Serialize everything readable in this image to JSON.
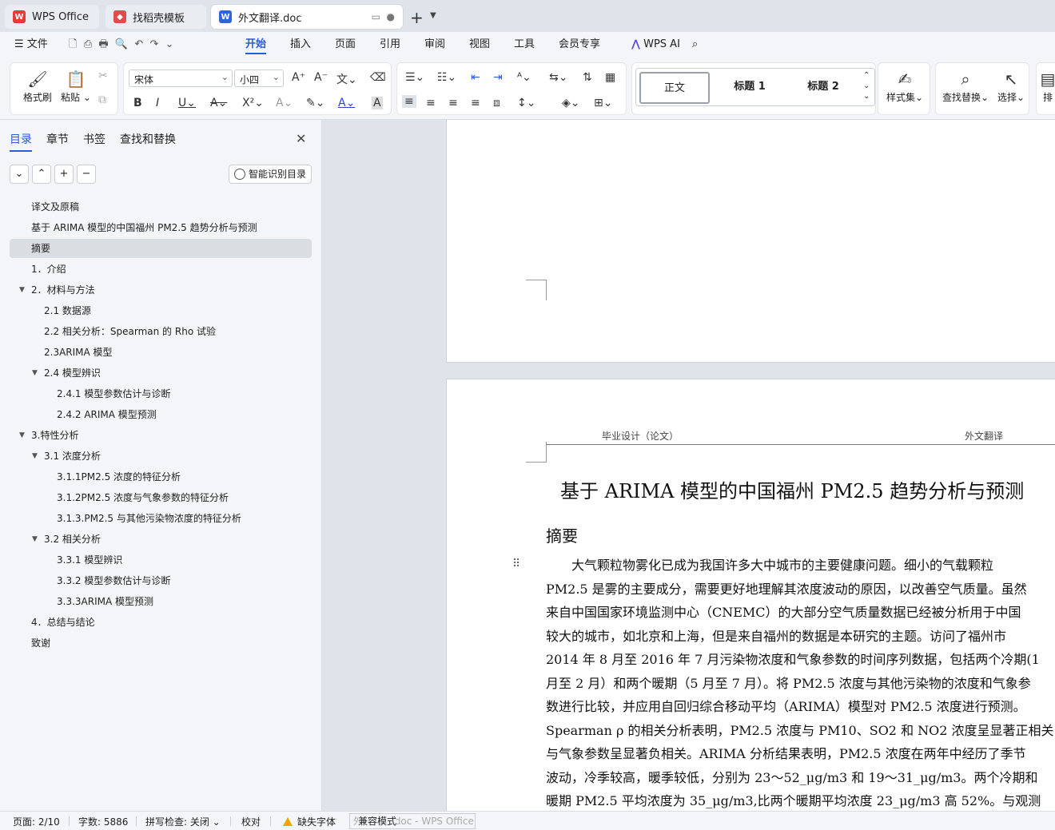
{
  "tabs": [
    {
      "label": "WPS Office",
      "icon": "wps-logo-icon"
    },
    {
      "label": "找稻壳模板",
      "icon": "docer-icon"
    },
    {
      "label": "外文翻译.doc",
      "icon": "writer-doc-icon"
    }
  ],
  "menu": {
    "file": "文件",
    "items": [
      "开始",
      "插入",
      "页面",
      "引用",
      "审阅",
      "视图",
      "工具",
      "会员专享"
    ],
    "active": "开始",
    "ai": "WPS AI"
  },
  "ribbon": {
    "format_painter": "格式刷",
    "paste": "粘贴",
    "font_name": "宋体",
    "font_size": "小四",
    "styles": [
      "正文",
      "标题 1",
      "标题 2"
    ],
    "style_set": "样式集",
    "find_replace": "查找替换",
    "select": "选择",
    "arrange": "排"
  },
  "nav": {
    "tabs": [
      "目录",
      "章节",
      "书签",
      "查找和替换"
    ],
    "active_tab": "目录",
    "smart_button": "智能识别目录",
    "toc": [
      {
        "text": "译文及原稿",
        "level": 1,
        "expanded": null
      },
      {
        "text": "基于 ARIMA 模型的中国福州 PM2.5 趋势分析与预测",
        "level": 1,
        "expanded": null
      },
      {
        "text": "摘要",
        "level": 1,
        "expanded": null,
        "selected": true
      },
      {
        "text": "1．介绍",
        "level": 1,
        "expanded": null
      },
      {
        "text": "2．材料与方法",
        "level": 1,
        "expanded": true
      },
      {
        "text": "2.1 数据源",
        "level": 2,
        "expanded": null
      },
      {
        "text": "2.2 相关分析：Spearman 的 Rho 试验",
        "level": 2,
        "expanded": null
      },
      {
        "text": "2.3ARIMA 模型",
        "level": 2,
        "expanded": null
      },
      {
        "text": "2.4 模型辨识",
        "level": 2,
        "expanded": true
      },
      {
        "text": "2.4.1 模型参数估计与诊断",
        "level": 3,
        "expanded": null
      },
      {
        "text": "2.4.2 ARIMA 模型预测",
        "level": 3,
        "expanded": null
      },
      {
        "text": "3.特性分析",
        "level": 1,
        "expanded": true
      },
      {
        "text": "3.1 浓度分析",
        "level": 2,
        "expanded": true
      },
      {
        "text": "3.1.1PM2.5 浓度的特征分析",
        "level": 3,
        "expanded": null
      },
      {
        "text": "3.1.2PM2.5 浓度与气象参数的特征分析",
        "level": 3,
        "expanded": null
      },
      {
        "text": "3.1.3.PM2.5 与其他污染物浓度的特征分析",
        "level": 3,
        "expanded": null
      },
      {
        "text": "3.2 相关分析",
        "level": 2,
        "expanded": true
      },
      {
        "text": "3.3.1 模型辨识",
        "level": 3,
        "expanded": null
      },
      {
        "text": "3.3.2 模型参数估计与诊断",
        "level": 3,
        "expanded": null
      },
      {
        "text": "3.3.3ARIMA 模型预测",
        "level": 3,
        "expanded": null
      },
      {
        "text": "4．总结与结论",
        "level": 1,
        "expanded": null
      },
      {
        "text": "致谢",
        "level": 1,
        "expanded": null
      }
    ]
  },
  "document": {
    "header_left": "毕业设计（论文）",
    "header_right": "外文翻译",
    "title": "基于 ARIMA 模型的中国福州 PM2.5 趋势分析与预测",
    "heading": "摘要",
    "lines": [
      "　　大气颗粒物雾化已成为我国许多大中城市的主要健康问题。细小的气载颗粒",
      "PM2.5 是雾的主要成分，需要更好地理解其浓度波动的原因，以改善空气质量。虽然",
      "来自中国国家环境监测中心（CNEMC）的大部分空气质量数据已经被分析用于中国",
      "较大的城市，如北京和上海，但是来自福州的数据是本研究的主题。访问了福州市",
      "2014 年 8 月至 2016 年 7 月污染物浓度和气象参数的时间序列数据，包括两个冷期(1",
      "月至 2 月）和两个暖期（5 月至 7 月）。将 PM2.5 浓度与其他污染物的浓度和气象参",
      "数进行比较，并应用自回归综合移动平均（ARIMA）模型对 PM2.5 浓度进行预测。",
      "Spearman ρ 的相关分析表明，PM2.5 浓度与 PM10、SO2 和 NO2 浓度呈显著正相关",
      "与气象参数呈显著负相关。ARIMA 分析结果表明，PM2.5 浓度在两年中经历了季节",
      "波动，冷季较高，暖季较低，分别为 23～52_μg/m3 和 19～31_μg/m3。两个冷期和",
      "暖期 PM2.5 平均浓度为 35_μg/m3,比两个暖期平均浓度 23_μg/m3 高 52%。与观测"
    ]
  },
  "status": {
    "page": "页面: 2/10",
    "words": "字数: 5886",
    "spell": "拼写检查: 关闭",
    "proof": "校对",
    "missing_font": "缺失字体",
    "compat": "兼容模式",
    "ghost_title": "外文翻译.doc - WPS Office"
  },
  "colors": {
    "accent": "#2a5cd8",
    "wps_red": "#e43a3a",
    "docer_red": "#e04b4b",
    "writer_blue": "#2f63e0"
  }
}
